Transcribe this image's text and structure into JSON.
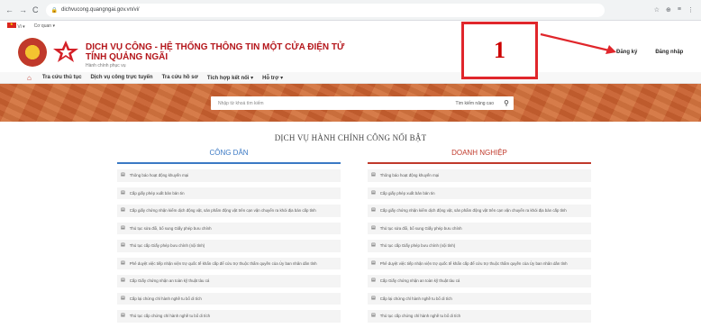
{
  "browser": {
    "back": "←",
    "forward": "→",
    "reload": "C",
    "url": "dichvucong.quangngai.gov.vn/vi/",
    "ext_icons": [
      "☆",
      "⊕",
      "≡",
      "⋮"
    ]
  },
  "utilbar": {
    "lang": "Vi",
    "agency": "Cơ quan"
  },
  "header": {
    "title_line1": "DỊCH VỤ CÔNG - HỆ THỐNG THÔNG TIN MỘT CỬA ĐIỆN TỬ",
    "title_line2": "TỈNH QUẢNG NGÃI",
    "subtitle": "Hành chính phục vụ",
    "callout_number": "1",
    "register_link": "Đăng ký",
    "login_link": "Đăng nhập"
  },
  "menu": {
    "items": [
      "Tra cứu thủ tục",
      "Dịch vụ công trực tuyến",
      "Tra cứu hồ sơ",
      "Tích hợp kết nối ▾",
      "Hỗ trợ ▾"
    ]
  },
  "search": {
    "placeholder": "Nhập từ khoá tìm kiếm",
    "advanced": "Tìm kiếm nâng cao"
  },
  "section": {
    "title": "DỊCH VỤ HÀNH CHÍNH CÔNG NỔI BẬT"
  },
  "citizen": {
    "heading": "CÔNG DÂN",
    "items": [
      "Thông báo hoạt động khuyến mại",
      "Cấp giấy phép xuất bản bản tin",
      "Cấp giấy chứng nhận kiểm dịch động vật, sản phẩm động vật trên cạn vận chuyển ra khỏi địa bàn cấp tỉnh",
      "Thủ tục sửa đổi, bổ sung Giấy phép bưu chính",
      "Thủ tục cấp Giấy phép bưu chính (nội tỉnh)",
      "Phê duyệt việc tiếp nhận viện trợ quốc tế khẩn cấp để cứu trợ thuộc thẩm quyền của Ủy ban nhân dân tỉnh",
      "Cấp Giấy chứng nhận an toàn kỹ thuật tàu cá",
      "Cấp lại chứng chỉ hành nghề tu bổ di tích",
      "Thủ tục cấp chứng chỉ hành nghề tu bổ di tích"
    ]
  },
  "business": {
    "heading": "DOANH NGHIỆP",
    "items": [
      "Thông báo hoạt động khuyến mại",
      "Cấp giấy phép xuất bản bản tin",
      "Cấp giấy chứng nhận kiểm dịch động vật, sản phẩm động vật trên cạn vận chuyển ra khỏi địa bàn cấp tỉnh",
      "Thủ tục sửa đổi, bổ sung Giấy phép bưu chính",
      "Thủ tục cấp Giấy phép bưu chính (nội tỉnh)",
      "Phê duyệt việc tiếp nhận viện trợ quốc tế khẩn cấp để cứu trợ thuộc thẩm quyền của Ủy ban nhân dân tỉnh",
      "Cấp Giấy chứng nhận an toàn kỹ thuật tàu cá",
      "Cấp lại chứng chỉ hành nghề tu bổ di tích",
      "Thủ tục cấp chứng chỉ hành nghề tu bổ di tích"
    ]
  },
  "colors": {
    "brand_red": "#b4161b",
    "citizen_blue": "#3b79c4",
    "business_red": "#c0392b",
    "banner_orange": "#c96a35"
  }
}
